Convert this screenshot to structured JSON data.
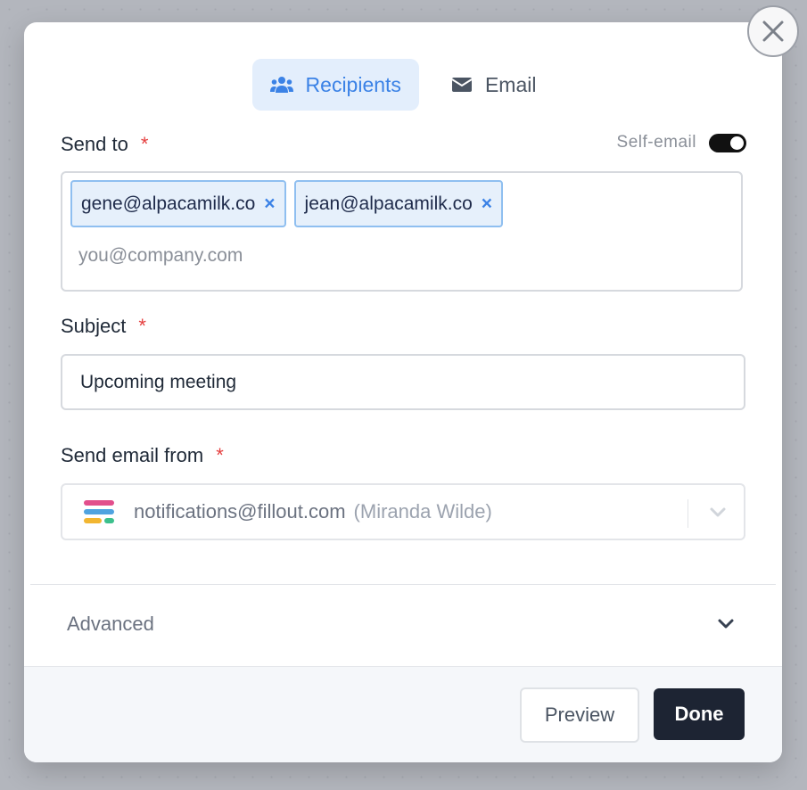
{
  "dialog": {
    "tabs": [
      {
        "label": "Recipients",
        "icon": "users-icon",
        "active": true
      },
      {
        "label": "Email",
        "icon": "envelope-icon",
        "active": false
      }
    ],
    "send_to": {
      "label": "Send to",
      "required_mark": "*",
      "self_email_label": "Self-email",
      "self_email_enabled": true,
      "recipients": [
        "gene@alpacamilk.co",
        "jean@alpacamilk.co"
      ],
      "remove_glyph": "×",
      "placeholder": "you@company.com"
    },
    "subject": {
      "label": "Subject",
      "required_mark": "*",
      "value": "Upcoming meeting"
    },
    "send_from": {
      "label": "Send email from",
      "required_mark": "*",
      "address": "notifications@fillout.com",
      "name": "(Miranda Wilde)",
      "disabled": true
    },
    "advanced": {
      "label": "Advanced"
    },
    "footer": {
      "preview_label": "Preview",
      "done_label": "Done"
    }
  },
  "colors": {
    "accent": "#3b82e6",
    "required": "#e53e3e",
    "done_button": "#1d2433",
    "active_tab_bg": "#e3eefc"
  }
}
